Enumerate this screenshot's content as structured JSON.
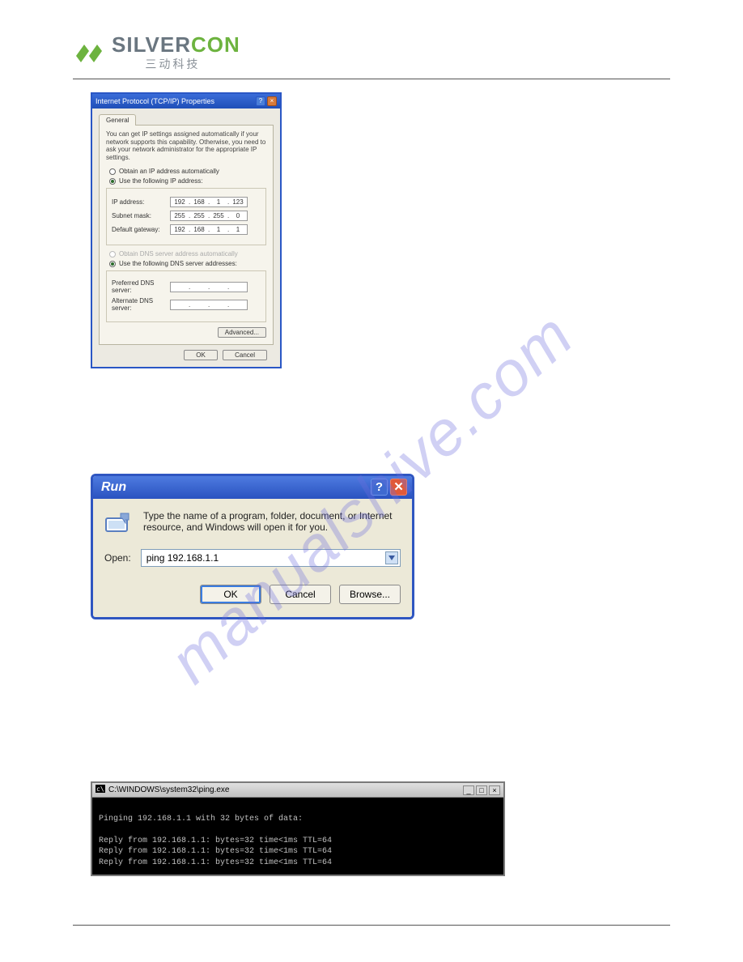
{
  "header": {
    "brand_part1": "SILVER",
    "brand_part2": "CON",
    "brand_sub": "三动科技"
  },
  "tcpip": {
    "title": "Internet Protocol (TCP/IP) Properties",
    "tab": "General",
    "description": "You can get IP settings assigned automatically if your network supports this capability. Otherwise, you need to ask your network administrator for the appropriate IP settings.",
    "radio_obtain_ip": "Obtain an IP address automatically",
    "radio_use_ip": "Use the following IP address:",
    "label_ip": "IP address:",
    "label_mask": "Subnet mask:",
    "label_gw": "Default gateway:",
    "ip": [
      "192",
      "168",
      "1",
      "123"
    ],
    "mask": [
      "255",
      "255",
      "255",
      "0"
    ],
    "gw": [
      "192",
      "168",
      "1",
      "1"
    ],
    "radio_obtain_dns": "Obtain DNS server address automatically",
    "radio_use_dns": "Use the following DNS server addresses:",
    "label_pref_dns": "Preferred DNS server:",
    "label_alt_dns": "Alternate DNS server:",
    "btn_advanced": "Advanced...",
    "btn_ok": "OK",
    "btn_cancel": "Cancel"
  },
  "run": {
    "title": "Run",
    "description": "Type the name of a program, folder, document, or Internet resource, and Windows will open it for you.",
    "label_open": "Open:",
    "input_value": "ping 192.168.1.1",
    "btn_ok": "OK",
    "btn_cancel": "Cancel",
    "btn_browse": "Browse..."
  },
  "console": {
    "title": "C:\\WINDOWS\\system32\\ping.exe",
    "lines": [
      "",
      "Pinging 192.168.1.1 with 32 bytes of data:",
      "",
      "Reply from 192.168.1.1: bytes=32 time<1ms TTL=64",
      "Reply from 192.168.1.1: bytes=32 time<1ms TTL=64",
      "Reply from 192.168.1.1: bytes=32 time<1ms TTL=64"
    ]
  },
  "watermark": "manualshive.com"
}
